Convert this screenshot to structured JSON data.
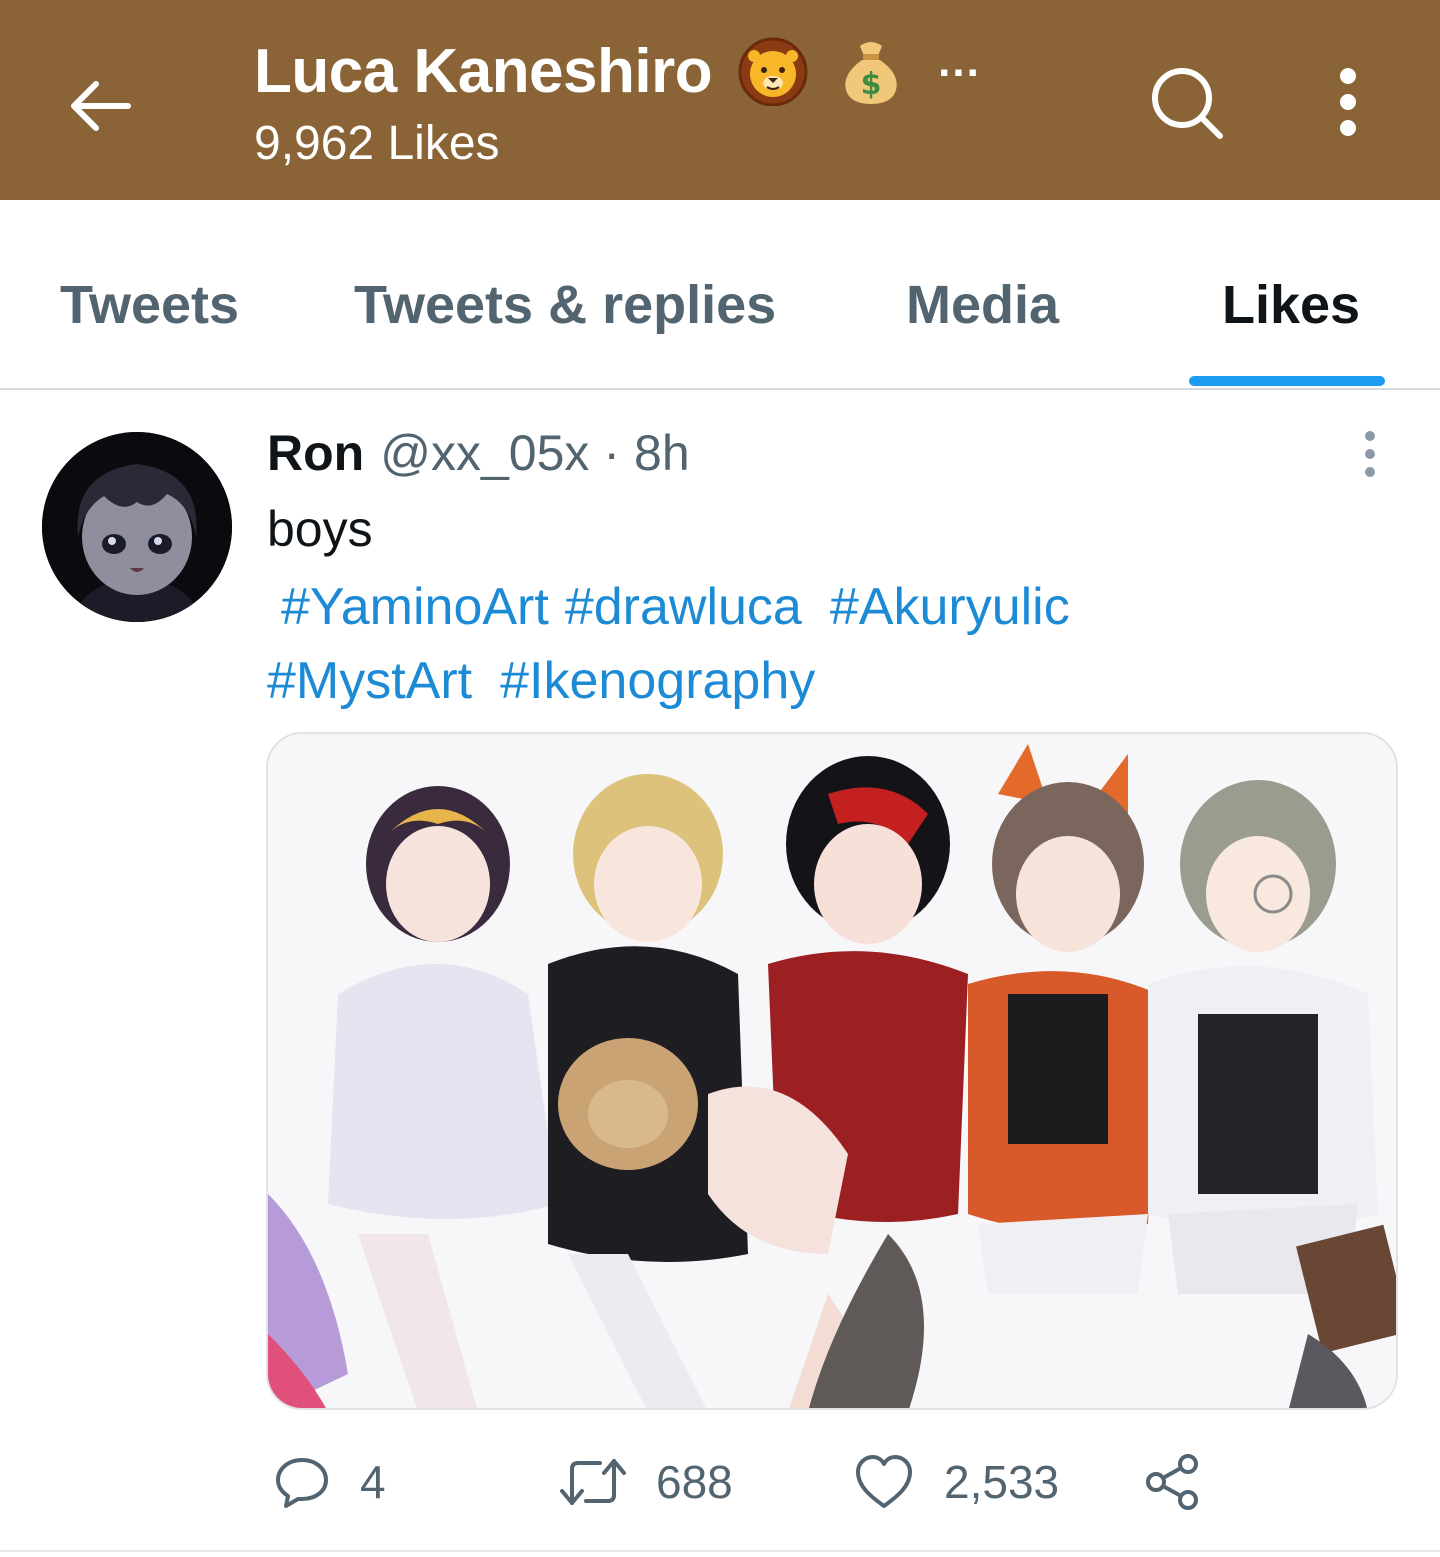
{
  "header": {
    "title": "Luca Kaneshiro",
    "title_emojis": [
      "lion-face-emoji",
      "money-bag-emoji"
    ],
    "title_ellipsis": "...",
    "subtitle": "9,962 Likes",
    "background_color": "#8a6436",
    "icons": [
      "back-arrow-icon",
      "search-icon",
      "more-vertical-icon"
    ]
  },
  "tabs": [
    {
      "label": "Tweets",
      "active": false
    },
    {
      "label": "Tweets & replies",
      "active": false
    },
    {
      "label": "Media",
      "active": false
    },
    {
      "label": "Likes",
      "active": true
    }
  ],
  "accent_color": "#1d9bf0",
  "tweet": {
    "author_name": "Ron",
    "handle": "@xx_05x",
    "separator": "·",
    "time": "8h",
    "text": "boys",
    "hashtags": [
      "#YaminoArt",
      "#drawluca",
      "#Akuryulic",
      "#MystArt",
      "#Ikenography"
    ],
    "media_description_icon": "illustration-image",
    "actions": {
      "replies": "4",
      "retweets": "688",
      "likes": "2,533"
    }
  }
}
